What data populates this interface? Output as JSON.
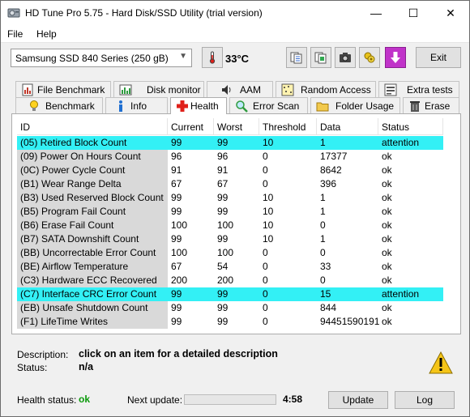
{
  "window": {
    "title": "HD Tune Pro 5.75 - Hard Disk/SSD Utility (trial version)",
    "controls": {
      "minimize": "—",
      "maximize": "☐",
      "close": "✕"
    }
  },
  "menu": [
    "File",
    "Help"
  ],
  "toolbar": {
    "drive": "Samsung SSD 840 Series (250 gB)",
    "temperature": "33°C",
    "exit_label": "Exit",
    "icons": [
      "copy-info-icon",
      "copy-screenshot-icon",
      "screenshot-icon",
      "options-icon",
      "save-icon"
    ]
  },
  "tabs_top": [
    {
      "label": "File Benchmark",
      "icon": "file-benchmark-icon"
    },
    {
      "label": "Disk monitor",
      "icon": "disk-monitor-icon"
    },
    {
      "label": "AAM",
      "icon": "speaker-icon"
    },
    {
      "label": "Random Access",
      "icon": "random-access-icon"
    },
    {
      "label": "Extra tests",
      "icon": "extra-tests-icon"
    }
  ],
  "tabs_bottom": [
    {
      "label": "Benchmark",
      "icon": "benchmark-icon"
    },
    {
      "label": "Info",
      "icon": "info-icon"
    },
    {
      "label": "Health",
      "icon": "health-cross-icon",
      "active": true
    },
    {
      "label": "Error Scan",
      "icon": "magnifier-icon"
    },
    {
      "label": "Folder Usage",
      "icon": "folder-icon"
    },
    {
      "label": "Erase",
      "icon": "trash-icon"
    }
  ],
  "table": {
    "columns": [
      "ID",
      "Current",
      "Worst",
      "Threshold",
      "Data",
      "Status"
    ],
    "rows": [
      {
        "id": "(05) Retired Block Count",
        "current": "99",
        "worst": "99",
        "threshold": "10",
        "data": "1",
        "status": "attention",
        "highlight": true
      },
      {
        "id": "(09) Power On Hours Count",
        "current": "96",
        "worst": "96",
        "threshold": "0",
        "data": "17377",
        "status": "ok"
      },
      {
        "id": "(0C) Power Cycle Count",
        "current": "91",
        "worst": "91",
        "threshold": "0",
        "data": "8642",
        "status": "ok"
      },
      {
        "id": "(B1) Wear Range Delta",
        "current": "67",
        "worst": "67",
        "threshold": "0",
        "data": "396",
        "status": "ok"
      },
      {
        "id": "(B3) Used Reserved Block Count",
        "current": "99",
        "worst": "99",
        "threshold": "10",
        "data": "1",
        "status": "ok"
      },
      {
        "id": "(B5) Program Fail Count",
        "current": "99",
        "worst": "99",
        "threshold": "10",
        "data": "1",
        "status": "ok"
      },
      {
        "id": "(B6) Erase Fail Count",
        "current": "100",
        "worst": "100",
        "threshold": "10",
        "data": "0",
        "status": "ok"
      },
      {
        "id": "(B7) SATA Downshift Count",
        "current": "99",
        "worst": "99",
        "threshold": "10",
        "data": "1",
        "status": "ok"
      },
      {
        "id": "(BB) Uncorrectable Error Count",
        "current": "100",
        "worst": "100",
        "threshold": "0",
        "data": "0",
        "status": "ok"
      },
      {
        "id": "(BE) Airflow Temperature",
        "current": "67",
        "worst": "54",
        "threshold": "0",
        "data": "33",
        "status": "ok"
      },
      {
        "id": "(C3) Hardware ECC Recovered",
        "current": "200",
        "worst": "200",
        "threshold": "0",
        "data": "0",
        "status": "ok"
      },
      {
        "id": "(C7) Interface CRC Error Count",
        "current": "99",
        "worst": "99",
        "threshold": "0",
        "data": "15",
        "status": "attention",
        "highlight": true
      },
      {
        "id": "(EB) Unsafe Shutdown Count",
        "current": "99",
        "worst": "99",
        "threshold": "0",
        "data": "844",
        "status": "ok"
      },
      {
        "id": "(F1) LifeTime Writes",
        "current": "99",
        "worst": "99",
        "threshold": "0",
        "data": "94451590191",
        "status": "ok"
      }
    ]
  },
  "details": {
    "description_label": "Description:",
    "description_value": "click on an item for a detailed description",
    "status_label": "Status:",
    "status_value": "n/a"
  },
  "footer": {
    "health_label": "Health status:",
    "health_value": "ok",
    "next_update_label": "Next update:",
    "progress_fraction": 0.0,
    "countdown": "4:58",
    "update_label": "Update",
    "log_label": "Log"
  },
  "colors": {
    "highlight_row": "#33f0f5",
    "health_ok": "#0a9a0a",
    "id_column_bg": "#d9d9d9"
  }
}
